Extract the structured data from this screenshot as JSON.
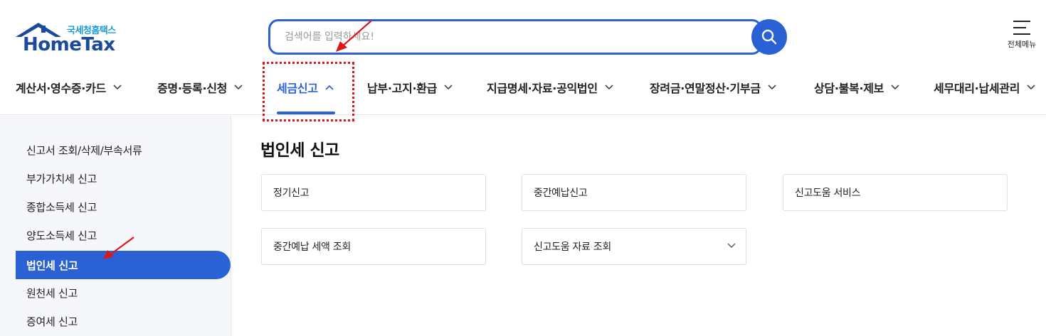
{
  "header": {
    "logo_sub": "국세청홈택스",
    "logo_main": "HomeTax",
    "search_placeholder": "검색어를 입력하세요!",
    "menu_label": "전체메뉴"
  },
  "nav": {
    "items": [
      {
        "label": "계산서·영수증·카드"
      },
      {
        "label": "증명·등록·신청"
      },
      {
        "label": "세금신고"
      },
      {
        "label": "납부·고지·환급"
      },
      {
        "label": "지급명세·자료·공익법인"
      },
      {
        "label": "장려금·연말정산·기부금"
      },
      {
        "label": "상담·불복·제보"
      },
      {
        "label": "세무대리·납세관리"
      }
    ],
    "active_index": 2
  },
  "sidebar": {
    "items": [
      {
        "label": "신고서 조회/삭제/부속서류"
      },
      {
        "label": "부가가치세 신고"
      },
      {
        "label": "종합소득세 신고"
      },
      {
        "label": "양도소득세 신고"
      },
      {
        "label": "법인세 신고"
      },
      {
        "label": "원천세 신고"
      },
      {
        "label": "증여세 신고"
      }
    ],
    "active_index": 4
  },
  "main": {
    "title": "법인세 신고",
    "cards": [
      {
        "label": "정기신고"
      },
      {
        "label": "중간예납신고"
      },
      {
        "label": "신고도움 서비스"
      },
      {
        "label": "중간예납 세액 조회"
      },
      {
        "label": "신고도움 자료 조회"
      }
    ]
  },
  "colors": {
    "accent": "#2a62d6",
    "annotation": "#e0151a",
    "logo_blue": "#1b4a9c",
    "logo_sub": "#1a9bd7"
  }
}
